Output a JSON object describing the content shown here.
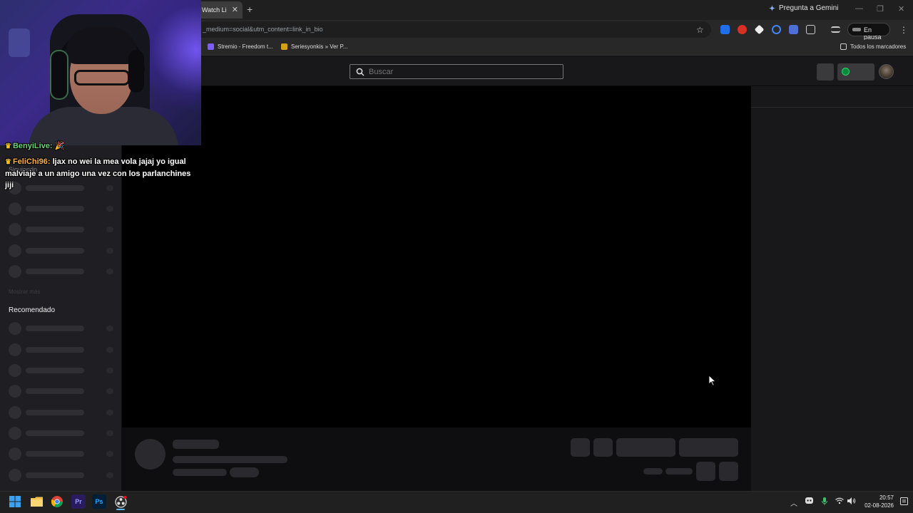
{
  "browser": {
    "tab_title": "Watch Li",
    "tab_close": "✕",
    "new_tab": "+",
    "gemini_label": "Pregunta a Gemini",
    "window_min": "—",
    "window_restore": "❐",
    "window_close": "✕",
    "url": "_medium=social&utm_content=link_in_bio",
    "pause_label": "En pausa",
    "bookmarks": [
      {
        "label": "Stremio - Freedom t...",
        "icon_color": "#7b5cff"
      },
      {
        "label": "Seriesyonkis » Ver P...",
        "icon_color": "#d4a017"
      }
    ],
    "all_bookmarks": "Todos los marcadores"
  },
  "twitch": {
    "search_placeholder": "Buscar",
    "sidebar": {
      "following_label": "Siguiendo",
      "show_more": "Mostrar más",
      "recommended_label": "Recomendado"
    }
  },
  "overlay_chat": [
    {
      "user": "BenyiLive:",
      "message": "🎉",
      "user_color": "#6dd67b"
    },
    {
      "user": "FeliChi96:",
      "message": "ljax no wei la mea vola jajaj yo igual malviaje a un amigo una vez con los parlanchines jiji",
      "user_color": "#ffb347"
    }
  ],
  "taskbar": {
    "apps": [
      "windows-start",
      "file-explorer",
      "chrome",
      "premiere-pro",
      "photoshop",
      "obs"
    ],
    "premiere_label": "Pr",
    "photoshop_label": "Ps",
    "time": "20:57",
    "date": "02-08-2026"
  },
  "colors": {
    "twitch_bg": "#0e0e10",
    "sidebar_bg": "#1f1f23",
    "skeleton": "#2a2a2e",
    "premiere_bg": "#2a1a5e",
    "premiere_fg": "#9b9bff",
    "photoshop_bg": "#001e36",
    "photoshop_fg": "#31a8ff"
  }
}
